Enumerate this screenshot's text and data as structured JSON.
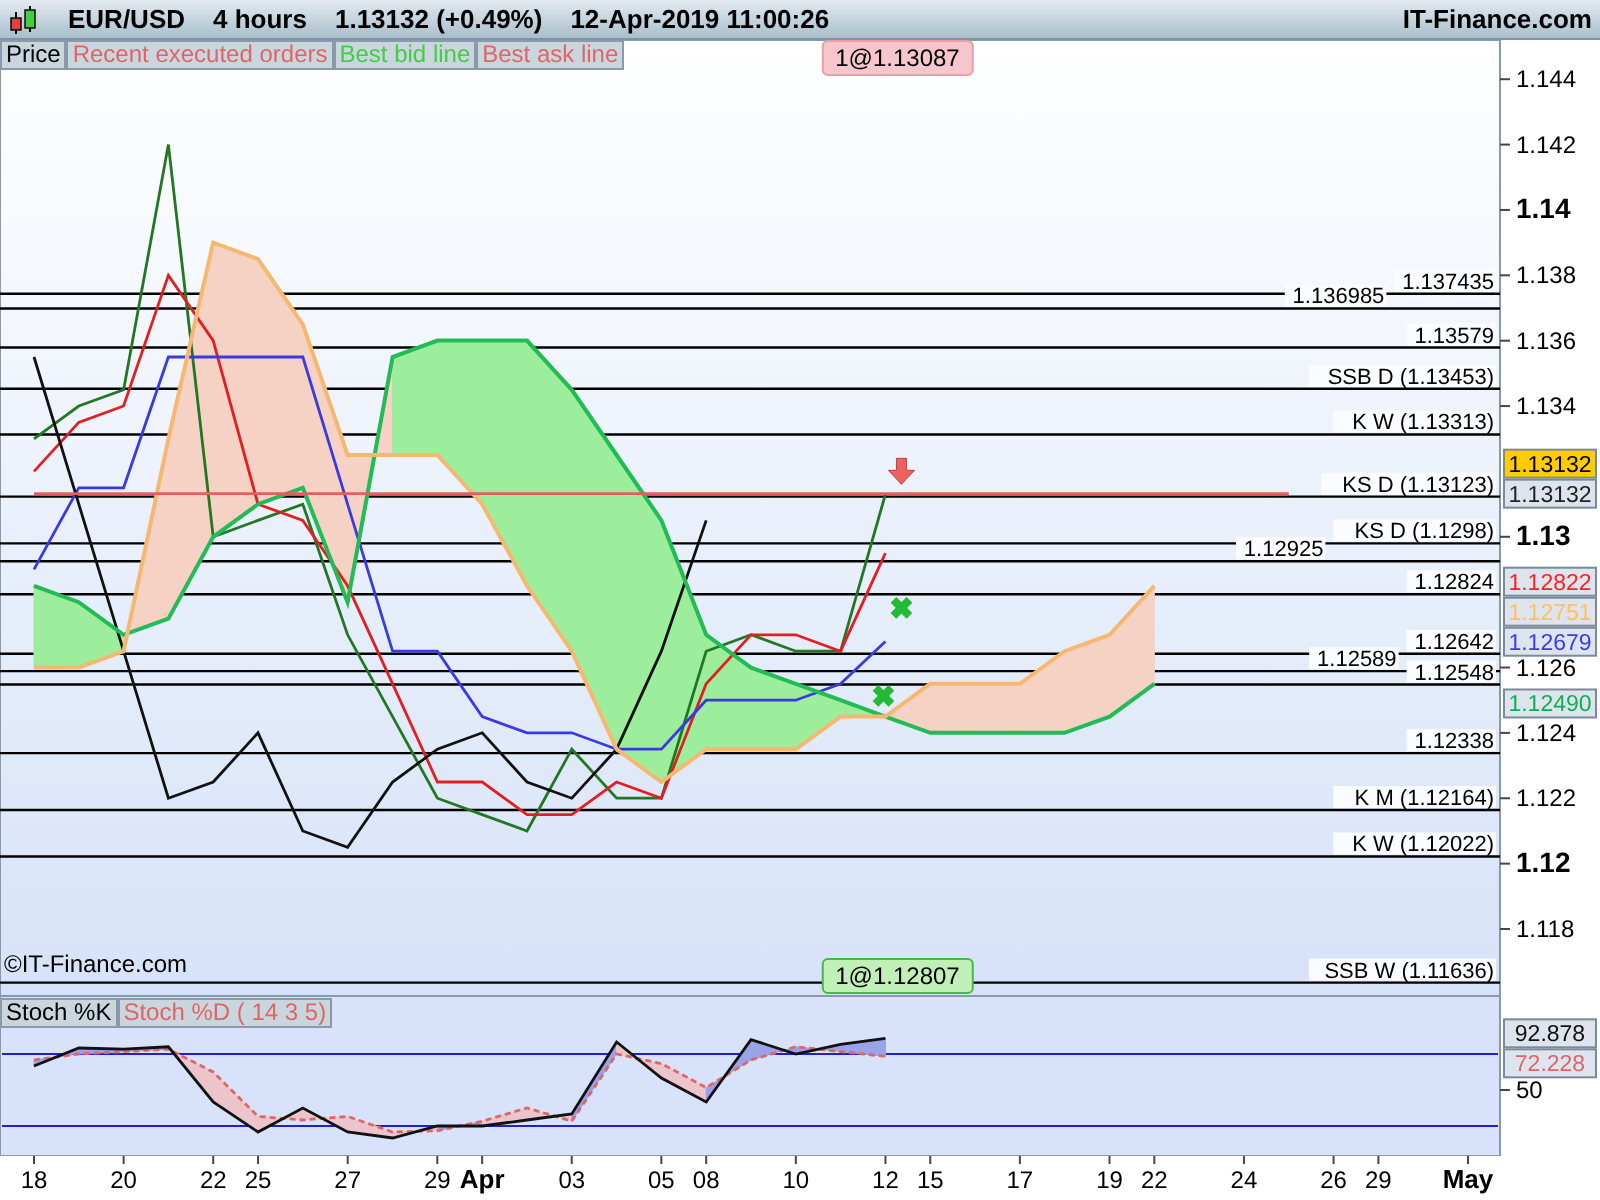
{
  "title_bar": {
    "symbol": "EUR/USD",
    "interval": "4 hours",
    "quote": "1.13132 (+0.49%)",
    "timestamp": "12-Apr-2019 11:00:26",
    "brand": "IT-Finance.com"
  },
  "price_panel": {
    "legend": [
      {
        "label": "Price",
        "color": "#000000"
      },
      {
        "label": "Recent executed orders",
        "color": "#e06666"
      },
      {
        "label": "Best bid line",
        "color": "#44cc44"
      },
      {
        "label": "Best ask line",
        "color": "#e06666"
      }
    ],
    "copyright": "©IT-Finance.com",
    "orders": [
      {
        "text": "1@1.13087",
        "kind": "ask"
      },
      {
        "text": "1@1.12807",
        "kind": "bid"
      }
    ],
    "levels": [
      {
        "label": "1.137435"
      },
      {
        "label": "1.136985"
      },
      {
        "label": "1.13579"
      },
      {
        "label": "SSB D (1.13453)"
      },
      {
        "label": "K W (1.13313)"
      },
      {
        "label": "KS D (1.13123)"
      },
      {
        "label": "KS D (1.1298)"
      },
      {
        "label": "1.12925"
      },
      {
        "label": "1.12824"
      },
      {
        "label": "1.12642"
      },
      {
        "label": "1.12589"
      },
      {
        "label": "1.12548"
      },
      {
        "label": "1.12338"
      },
      {
        "label": "K M (1.12164)"
      },
      {
        "label": "K W (1.12022)"
      },
      {
        "label": "SSB W (1.11636)"
      }
    ],
    "last_price": "1.13132",
    "price_tags": [
      {
        "text": "1.13132",
        "color": "#222222"
      },
      {
        "text": "1.12822",
        "color": "#ff2020"
      },
      {
        "text": "1.12751",
        "color": "#ffc060"
      },
      {
        "text": "1.12679",
        "color": "#3a3af0"
      },
      {
        "text": "1.12490",
        "color": "#10b050"
      }
    ],
    "chart_data": {
      "type": "line",
      "categories": [
        "18",
        null,
        "20",
        null,
        "22",
        "25",
        null,
        "27",
        null,
        "29",
        "Apr",
        null,
        "03",
        null,
        "05",
        "08",
        null,
        "10",
        null,
        "12",
        "15",
        null,
        "17",
        null,
        "19",
        "22",
        null,
        "24",
        null,
        "26",
        "29",
        null,
        "May"
      ],
      "ylim": [
        1.11595,
        1.1452
      ],
      "yticks": [
        {
          "value": 1.144,
          "label": "1.144"
        },
        {
          "value": 1.142,
          "label": "1.142"
        },
        {
          "value": 1.14,
          "label": "1.14"
        },
        {
          "value": 1.138,
          "label": "1.138"
        },
        {
          "value": 1.136,
          "label": "1.136"
        },
        {
          "value": 1.134,
          "label": "1.134"
        },
        {
          "value": 1.13,
          "label": "1.13"
        },
        {
          "value": 1.126,
          "label": "1.126"
        },
        {
          "value": 1.124,
          "label": "1.124"
        },
        {
          "value": 1.122,
          "label": "1.122"
        },
        {
          "value": 1.12,
          "label": "1.12"
        },
        {
          "value": 1.118,
          "label": "1.118"
        }
      ],
      "series": [
        {
          "color": "#227722",
          "values": [
            1.133,
            1.134,
            1.1345,
            1.142,
            1.13,
            1.1305,
            1.131,
            1.127,
            1.1245,
            1.122,
            1.1215,
            1.121,
            1.1235,
            1.122,
            1.122,
            1.1265,
            1.127,
            1.1265,
            1.1265,
            1.1313,
            null,
            null,
            null,
            null,
            null,
            null,
            null,
            null,
            null,
            null,
            null,
            null,
            null
          ]
        },
        {
          "color": "#e02020",
          "values": [
            1.132,
            1.1335,
            1.134,
            1.138,
            1.136,
            1.131,
            1.1305,
            1.1285,
            1.1255,
            1.1225,
            1.1225,
            1.1215,
            1.1215,
            1.1225,
            1.122,
            1.1255,
            1.127,
            1.127,
            1.1265,
            1.1295,
            null,
            null,
            null,
            null,
            null,
            null,
            null,
            null,
            null,
            null,
            null,
            null,
            null
          ]
        },
        {
          "color": "#3a3ae0",
          "values": [
            1.129,
            1.1315,
            1.1315,
            1.1355,
            1.1355,
            1.1355,
            1.1355,
            1.131,
            1.1265,
            1.1265,
            1.1245,
            1.124,
            1.124,
            1.1235,
            1.1235,
            1.125,
            1.125,
            1.125,
            1.1255,
            1.1268,
            null,
            null,
            null,
            null,
            null,
            null,
            null,
            null,
            null,
            null,
            null,
            null,
            null
          ]
        },
        {
          "color": "#111111",
          "values": [
            1.1355,
            1.131,
            1.1265,
            1.122,
            1.1225,
            1.124,
            1.121,
            1.1205,
            1.1225,
            1.1235,
            1.124,
            1.1225,
            1.122,
            1.1235,
            1.1265,
            1.1305,
            null,
            null,
            null,
            null,
            null,
            null,
            null,
            null,
            null,
            null,
            null,
            null,
            null,
            null,
            null,
            null,
            null
          ]
        },
        {
          "color": "#22bb55",
          "values": [
            1.1285,
            1.128,
            1.127,
            1.1275,
            1.13,
            1.131,
            1.1315,
            1.128,
            1.1355,
            1.136,
            1.136,
            1.136,
            1.1345,
            1.1325,
            1.1305,
            1.127,
            1.126,
            1.1255,
            1.125,
            1.1245,
            1.124,
            1.124,
            1.124,
            1.124,
            1.1245,
            1.1255,
            null,
            null,
            null,
            null,
            null,
            null,
            null
          ]
        },
        {
          "color": "#f5b870",
          "values": [
            1.126,
            1.126,
            1.1265,
            1.133,
            1.139,
            1.1385,
            1.1365,
            1.1325,
            1.1325,
            1.1325,
            1.131,
            1.1285,
            1.1265,
            1.1235,
            1.1225,
            1.1235,
            1.1235,
            1.1235,
            1.1245,
            1.1245,
            1.1255,
            1.1255,
            1.1255,
            1.1265,
            1.127,
            1.1285,
            null,
            null,
            null,
            null,
            null,
            null,
            null
          ]
        },
        {
          "color": "#e06060",
          "values": [
            1.13132,
            1.13132,
            1.13132,
            1.13132,
            1.13132,
            1.13132,
            1.13132,
            1.13132,
            1.13132,
            1.13132,
            1.13132,
            1.13132,
            1.13132,
            1.13132,
            1.13132,
            1.13132,
            1.13132,
            1.13132,
            1.13132,
            1.13132,
            1.13132,
            1.13132,
            1.13132,
            1.13132,
            1.13132,
            1.13132,
            1.13132,
            1.13132,
            1.13132,
            null,
            null,
            null,
            null
          ]
        }
      ]
    }
  },
  "stoch_panel": {
    "legend": [
      {
        "label": "Stoch %K",
        "color": "#000000"
      },
      {
        "label": "Stoch %D ( 14 3 5)",
        "color": "#e06666"
      }
    ],
    "scale_label": "50",
    "stoch_tags": [
      {
        "text": "92.878",
        "color": "#111111"
      },
      {
        "text": "72.228",
        "color": "#e06666"
      }
    ]
  }
}
